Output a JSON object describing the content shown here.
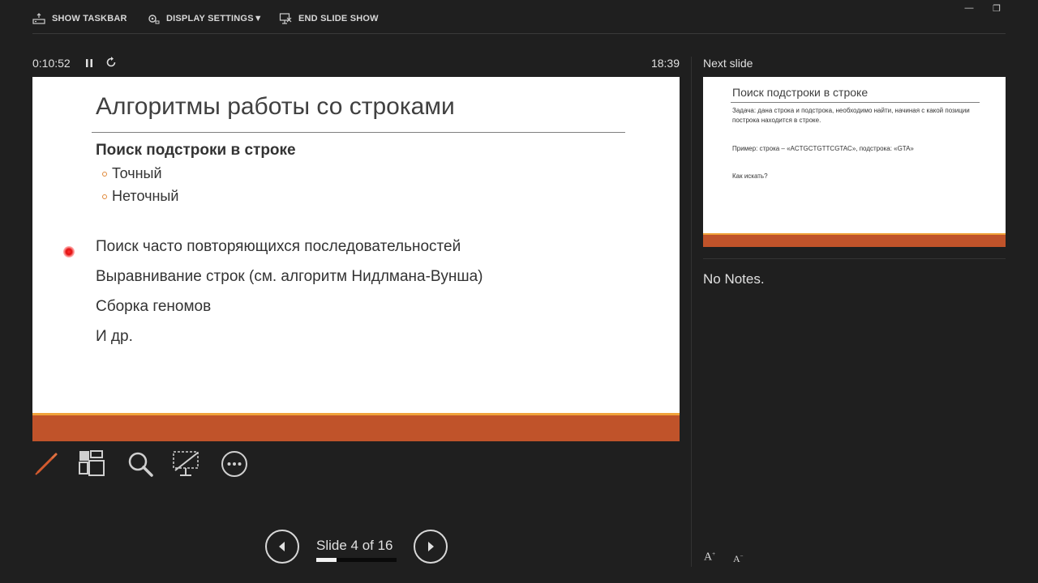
{
  "toolbar": {
    "show_taskbar": "SHOW TASKBAR",
    "display_settings": "DISPLAY SETTINGS",
    "display_settings_caret": "▼",
    "end_slide_show": "END SLIDE SHOW",
    "icons": [
      "taskbar-icon",
      "display-settings-icon",
      "end-slide-show-icon"
    ]
  },
  "window_controls": {
    "minimize": "—",
    "restore": "❐"
  },
  "timer": {
    "elapsed": "0:10:52",
    "clock": "18:39"
  },
  "slide": {
    "title": "Алгоритмы работы со строками",
    "heading": "Поиск подстроки в строке",
    "subitems": [
      "Точный",
      "Неточный"
    ],
    "points": [
      "Поиск часто повторяющихся последовательностей",
      "Выравнивание строк (см. алгоритм Нидлмана-Вунша)",
      "Сборка геномов",
      "И др."
    ]
  },
  "tools": [
    "pen-icon",
    "see-all-slides-icon",
    "zoom-icon",
    "black-screen-icon",
    "more-options-icon"
  ],
  "navigation": {
    "counter": "Slide 4 of 16",
    "progress": 0.25
  },
  "next_slide": {
    "label": "Next slide",
    "title": "Поиск подстроки в строке",
    "line1": "Задача: дана строка и подстрока, необходимо найти, начиная с какой позиции построка находится в строке.",
    "line2": "Пример: строка – «ACTGCTGTTCGTAC», подстрока: «GTA»",
    "line3": "Как искать?"
  },
  "notes": "No Notes.",
  "font_controls": {
    "increase": "A",
    "decrease": "A"
  },
  "colors": {
    "accent": "#c0532a",
    "accent_line": "#f0a23a",
    "laser": "#e01010"
  }
}
